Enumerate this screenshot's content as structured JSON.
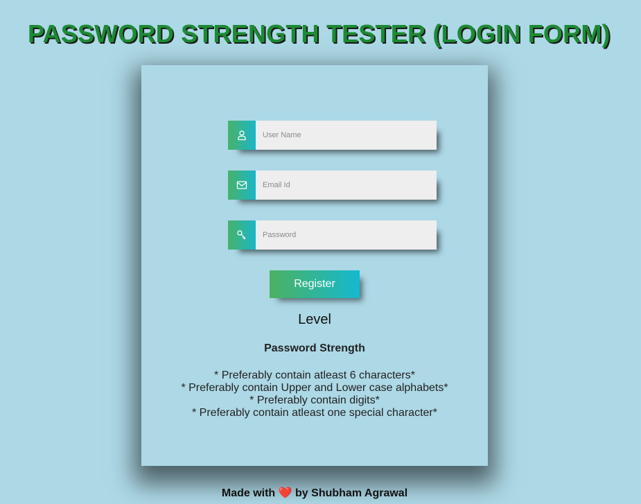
{
  "page": {
    "title": "PASSWORD STRENGTH TESTER (LOGIN FORM)"
  },
  "form": {
    "username": {
      "placeholder": "User Name",
      "value": "",
      "icon": "user-icon"
    },
    "email": {
      "placeholder": "Email Id",
      "value": "",
      "icon": "envelope-icon"
    },
    "password": {
      "placeholder": "Password",
      "value": "",
      "icon": "key-icon"
    },
    "register_label": "Register"
  },
  "strength": {
    "level_label": "Level",
    "heading": "Password Strength",
    "rules": [
      "* Preferably contain atleast 6 characters*",
      "* Preferably contain Upper and Lower case alphabets*",
      "* Preferably contain digits*",
      "* Preferably contain atleast one special character*"
    ]
  },
  "footer": {
    "prefix": "Made with",
    "heart": "❤️",
    "suffix": "by Shubham Agrawal"
  },
  "colors": {
    "background": "#add8e6",
    "title": "#1d8a34",
    "gradient_start": "#47b26c",
    "gradient_end": "#1cb6c7"
  }
}
